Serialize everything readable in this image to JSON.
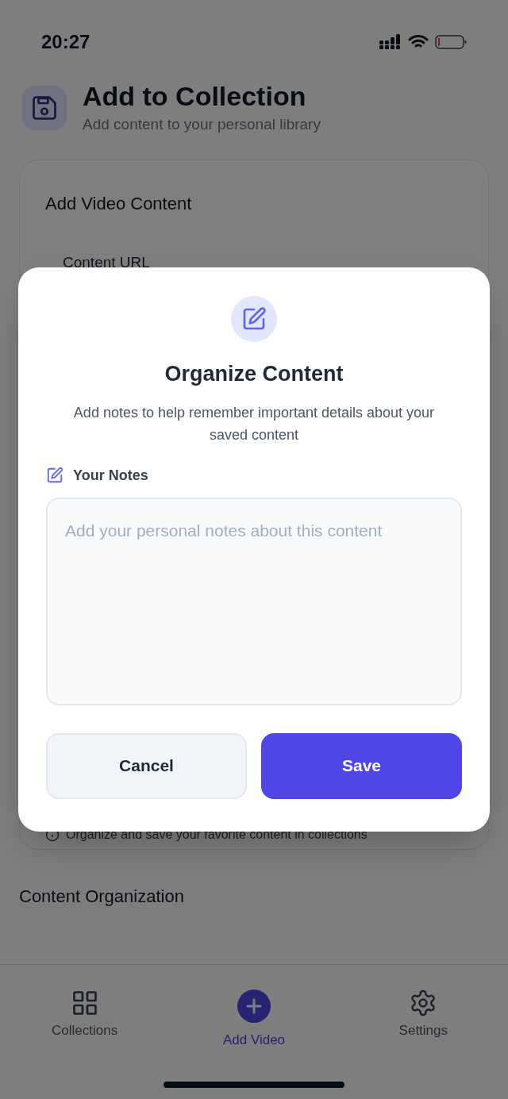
{
  "status_bar": {
    "time": "20:27"
  },
  "header": {
    "title": "Add to Collection",
    "subtitle": "Add content to your personal library"
  },
  "card": {
    "title": "Add Video Content",
    "field_label": "Content URL",
    "info": "Organize and save your favorite content in collections"
  },
  "section_title": "Content Organization",
  "tab_bar": [
    {
      "label": "Collections",
      "kind": "grid",
      "selected": false
    },
    {
      "label": "Add Video",
      "kind": "plus",
      "selected": true
    },
    {
      "label": "Settings",
      "kind": "gear",
      "selected": false
    }
  ],
  "dialog": {
    "title": "Organize Content",
    "description": "Add notes to help remember important details about your saved content",
    "notes_label": "Your Notes",
    "notes": {
      "placeholder": "Add your personal notes about this content"
    },
    "buttons": [
      {
        "label": "Cancel",
        "kind": "secondary"
      },
      {
        "label": "Save",
        "kind": "primary"
      }
    ]
  }
}
